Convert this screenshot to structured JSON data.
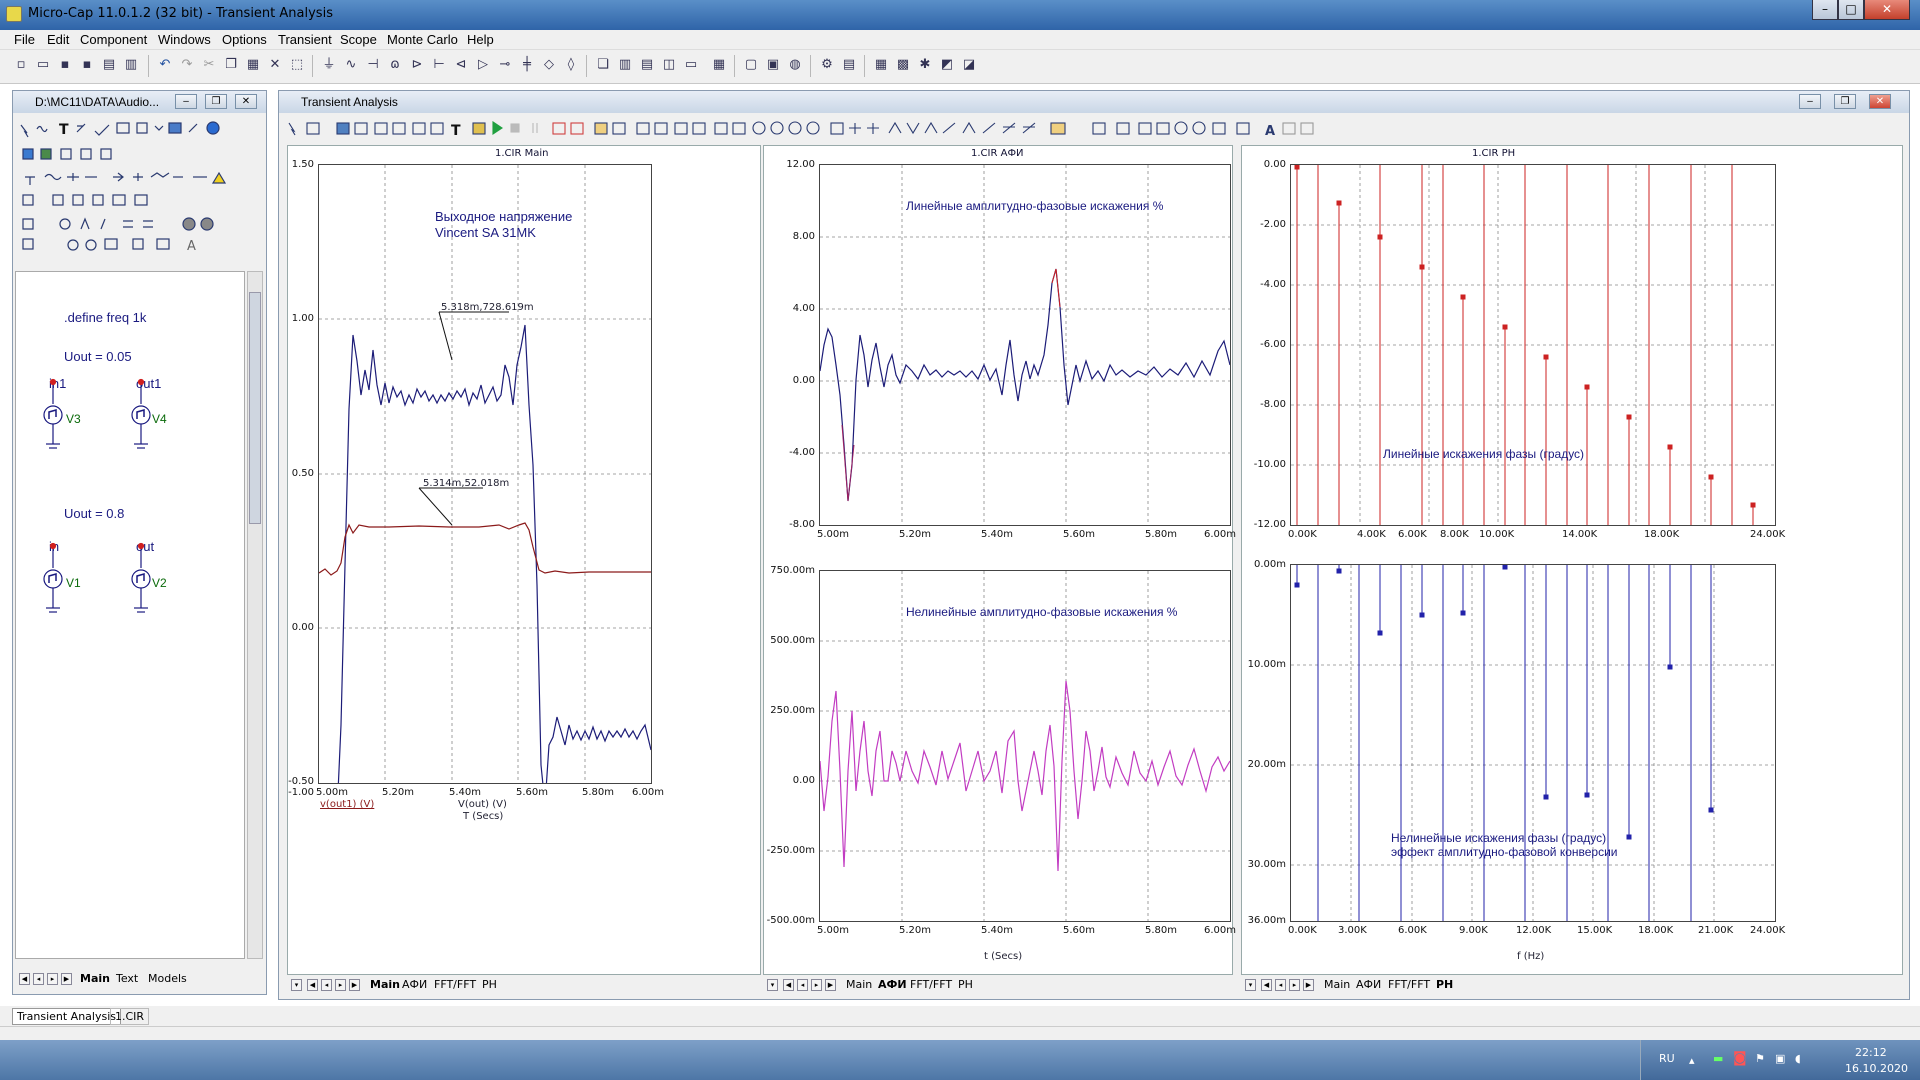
{
  "window": {
    "title": "Micro-Cap 11.0.1.2 (32 bit) - Transient Analysis",
    "minimize": "–",
    "restore": "□",
    "close": "✕"
  },
  "menu": [
    "File",
    "Edit",
    "Component",
    "Windows",
    "Options",
    "Transient",
    "Scope",
    "Monte Carlo",
    "Help"
  ],
  "circuit_window": {
    "title": "D:\\MC11\\DATA\\Audio...",
    "define_text": ".define freq 1k",
    "param1": "Uout = 0.05",
    "param2": "Uout = 0.8",
    "nodes": [
      "in1",
      "out1",
      "in",
      "out"
    ],
    "sources": [
      "V3",
      "V4",
      "V1",
      "V2"
    ],
    "tabs": [
      "Main",
      "Text",
      "Models"
    ]
  },
  "analysis_window": {
    "title": "Transient Analysis",
    "panel_main": {
      "title": "1.CIR Main",
      "annotation_line1": "Выходное напряжение",
      "annotation_line2": "Vincent SA 31MK",
      "marker1": "5.318m,728.619m",
      "marker2": "5.314m,52.018m",
      "y_ticks": [
        "1.50",
        "1.00",
        "0.50",
        "0.00",
        "-0.50",
        "-1.00"
      ],
      "x_ticks": [
        "5.00m",
        "5.20m",
        "5.40m",
        "5.60m",
        "5.80m",
        "6.00m"
      ],
      "legend1": "v(out1) (V)",
      "legend2": "V(out) (V)",
      "xlabel": "T (Secs)",
      "tabs": [
        "Main",
        "АФИ",
        "FFT/FFT",
        "PH"
      ]
    },
    "panel_afi": {
      "title": "1.CIR АФИ",
      "top_annotation": "Линейные амплитудно-фазовые искажения %",
      "bottom_annotation": "Нелинейные амплитудно-фазовые искажения %",
      "top_y_ticks": [
        "12.00",
        "8.00",
        "4.00",
        "0.00",
        "-4.00",
        "-8.00"
      ],
      "bottom_y_ticks": [
        "750.00m",
        "500.00m",
        "250.00m",
        "0.00",
        "-250.00m",
        "-500.00m"
      ],
      "x_ticks": [
        "5.00m",
        "5.20m",
        "5.40m",
        "5.60m",
        "5.80m",
        "6.00m"
      ],
      "xlabel": "t (Secs)",
      "tabs": [
        "Main",
        "АФИ",
        "FFT/FFT",
        "PH"
      ]
    },
    "panel_ph": {
      "title": "1.CIR PH",
      "top_annotation": "Линейные искажения фазы     (градус)",
      "bottom_annotation_line1": "Нелинейные искажения фазы (градус)",
      "bottom_annotation_line2": "эффект амплитудно-фазовой конверсии",
      "top_y_ticks": [
        "0.00",
        "-2.00",
        "-4.00",
        "-6.00",
        "-8.00",
        "-10.00",
        "-12.00"
      ],
      "top_x_ticks": [
        "0.00K",
        "4.00K",
        "6.00K",
        "8.00K",
        "10.00K",
        "14.00K",
        "18.00K",
        "24.00K"
      ],
      "bottom_y_ticks": [
        "0.00m",
        "10.00m",
        "20.00m",
        "30.00m",
        "36.00m"
      ],
      "bottom_x_ticks": [
        "0.00K",
        "3.00K",
        "6.00K",
        "9.00K",
        "12.00K",
        "15.00K",
        "18.00K",
        "21.00K",
        "24.00K"
      ],
      "xlabel": "f (Hz)",
      "tabs": [
        "Main",
        "АФИ",
        "FFT/FFT",
        "PH"
      ]
    }
  },
  "bottom_tabs": [
    "Transient Analysis",
    "1.CIR"
  ],
  "taskbar": {
    "lang": "RU",
    "time": "22:12",
    "date": "16.10.2020"
  },
  "colors": {
    "trace_main_blue": "#1c1c78",
    "trace_main_red": "#8b1a1a",
    "trace_afi_top": "#1c1c78",
    "trace_afi_bottom": "#c23cc2",
    "ph_top": "#cc2222",
    "ph_bottom": "#2222aa",
    "annotation": "#1a1a80"
  }
}
